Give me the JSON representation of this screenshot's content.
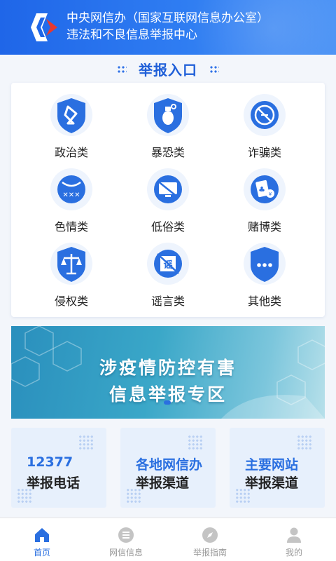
{
  "header": {
    "title_line1": "中央网信办（国家互联网信息办公室）",
    "title_line2": "违法和不良信息举报中心"
  },
  "section": {
    "title": "举报入口"
  },
  "categories": [
    {
      "label": "政治类",
      "icon": "political-shield-icon"
    },
    {
      "label": "暴恐类",
      "icon": "grenade-shield-icon"
    },
    {
      "label": "诈骗类",
      "icon": "fraud-no-icon"
    },
    {
      "label": "色情类",
      "icon": "pornography-icon"
    },
    {
      "label": "低俗类",
      "icon": "vulgar-screen-icon"
    },
    {
      "label": "赌博类",
      "icon": "gambling-cards-icon"
    },
    {
      "label": "侵权类",
      "icon": "scales-shield-icon"
    },
    {
      "label": "谣言类",
      "icon": "rumor-icon"
    },
    {
      "label": "其他类",
      "icon": "other-shield-icon"
    }
  ],
  "banner": {
    "line1": "涉疫情防控有害",
    "line2": "信息举报专区"
  },
  "cards": [
    {
      "line1": "12377",
      "line2": "举报电话"
    },
    {
      "line1": "各地网信办",
      "line2": "举报渠道"
    },
    {
      "line1": "主要网站",
      "line2": "举报渠道"
    }
  ],
  "tabs": [
    {
      "label": "首页",
      "icon": "home-icon",
      "active": true
    },
    {
      "label": "网信信息",
      "icon": "news-list-icon",
      "active": false
    },
    {
      "label": "举报指南",
      "icon": "compass-icon",
      "active": false
    },
    {
      "label": "我的",
      "icon": "user-icon",
      "active": false
    }
  ],
  "colors": {
    "brand_blue": "#2a6fe0",
    "header_blue": "#1f66e8",
    "logo_red": "#e8392f"
  }
}
